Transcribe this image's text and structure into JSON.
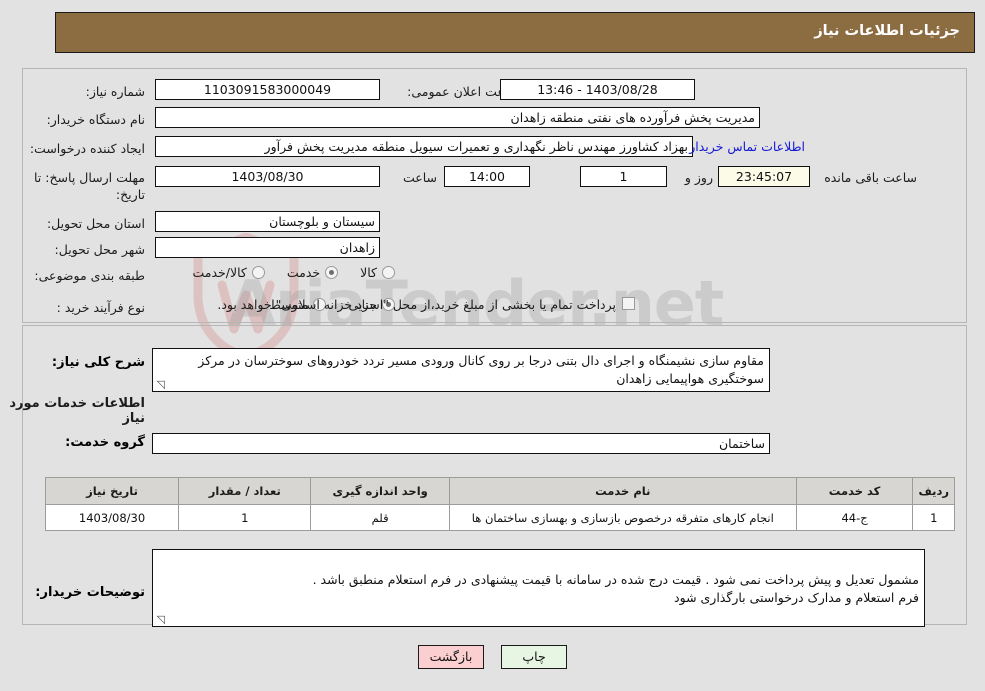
{
  "header": {
    "title": "جزئیات اطلاعات نیاز"
  },
  "fields": {
    "need_number": {
      "label": "شماره نیاز:",
      "value": "1103091583000049"
    },
    "announce_datetime": {
      "label": "تاریخ و ساعت اعلان عمومی:",
      "value": "1403/08/28 - 13:46"
    },
    "buyer_org": {
      "label": "نام دستگاه خریدار:",
      "value": "مدیریت پخش فرآورده های نفتی منطقه زاهدان"
    },
    "requester": {
      "label": "ایجاد کننده درخواست:",
      "value": "بهزاد کشاورز مهندس ناظر نگهداری و تعمیرات سیویل منطقه  مدیریت پخش فرآور"
    },
    "contact_link": "اطلاعات تماس خریدار",
    "deadline": {
      "label": "مهلت ارسال پاسخ: تا تاریخ:",
      "date": "1403/08/30",
      "time_label": "ساعت",
      "time": "14:00",
      "days": "1",
      "days_suffix": "روز و",
      "countdown": "23:45:07",
      "countdown_suffix": "ساعت باقی مانده"
    },
    "province": {
      "label": "استان محل تحویل:",
      "value": "سیستان و بلوچستان"
    },
    "city": {
      "label": "شهر محل تحویل:",
      "value": "زاهدان"
    },
    "category": {
      "label": "طبقه بندی موضوعی:",
      "options": [
        "کالا",
        "خدمت",
        "کالا/خدمت"
      ],
      "selected": "خدمت"
    },
    "purchase_type": {
      "label": "نوع فرآیند خرید :",
      "options": [
        "جزیی",
        "متوسط"
      ],
      "selected": "جزیی",
      "checkbox_label": "پرداخت تمام یا بخشی از مبلغ خرید،از محل \"اسناد خزانه اسلامی\" خواهد بود.",
      "checkbox_checked": false
    },
    "general_desc": {
      "label": "شرح کلی نیاز:",
      "value": "مقاوم سازی نشیمنگاه و اجرای دال بتنی درجا بر روی کانال ورودی مسیر تردد خودروهای سوخترسان در مرکز سوختگیری هواپیمایی زاهدان"
    },
    "services_section_title": "اطلاعات خدمات مورد نیاز",
    "service_group": {
      "label": "گروه خدمت:",
      "value": "ساختمان"
    },
    "buyer_notes": {
      "label": "توضیحات خریدار:",
      "value": "مشمول تعدیل و پیش پرداخت نمی شود . قیمت درج شده در سامانه با قیمت پیشنهادی  در فرم استعلام منطبق باشد .\nفرم استعلام و مدارک درخواستی بارگذاری شود"
    }
  },
  "table": {
    "headers": [
      "ردیف",
      "کد خدمت",
      "نام خدمت",
      "واحد اندازه گیری",
      "تعداد / مقدار",
      "تاریخ نیاز"
    ],
    "rows": [
      {
        "row_no": "1",
        "service_code": "ج-44",
        "service_name": "انجام کارهای متفرقه درخصوص بازسازی و بهسازی ساختمان ها",
        "unit": "قلم",
        "quantity": "1",
        "need_date": "1403/08/30"
      }
    ]
  },
  "buttons": {
    "back": "بازگشت",
    "print": "چاپ"
  },
  "watermark": {
    "text": "AriaTender.net"
  },
  "colors": {
    "header_bar": "#8c6d42",
    "page_bg": "#e2e2e2",
    "link": "#1419d6",
    "back_btn": "#fbcfcf",
    "print_btn": "#e6f6e2",
    "table_header": "#d8d6d2",
    "countdown_bg": "#fbfbe8"
  }
}
